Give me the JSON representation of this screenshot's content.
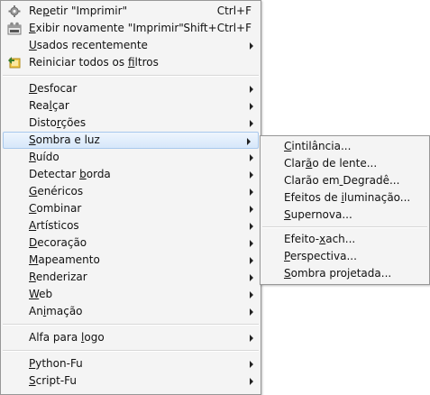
{
  "main_menu": {
    "items": [
      {
        "label": "Repetir \"Imprimir\"",
        "underline_index": 2,
        "shortcut": "Ctrl+F",
        "icon": "repeat-gear-icon"
      },
      {
        "label": "Exibir novamente \"Imprimir\"",
        "underline_index": 0,
        "shortcut": "Shift+Ctrl+F",
        "icon": "reshow-dialog-icon"
      },
      {
        "label": "Usados recentemente",
        "underline_index": 0,
        "submenu": true
      },
      {
        "label": "Reiniciar todos os filtros",
        "underline_index": 19,
        "icon": "reset-filters-icon"
      },
      {
        "label": "Desfocar",
        "underline_index": 0,
        "submenu": true
      },
      {
        "label": "Realçar",
        "underline_index": 3,
        "submenu": true
      },
      {
        "label": "Distorções",
        "underline_index": 5,
        "submenu": true
      },
      {
        "label": "Sombra e luz",
        "underline_index": 0,
        "submenu": true,
        "highlighted": true
      },
      {
        "label": "Ruído",
        "underline_index": 0,
        "submenu": true
      },
      {
        "label": "Detectar borda",
        "underline_index": 9,
        "submenu": true
      },
      {
        "label": "Genéricos",
        "underline_index": 0,
        "submenu": true
      },
      {
        "label": "Combinar",
        "underline_index": 0,
        "submenu": true
      },
      {
        "label": "Artísticos",
        "underline_index": 0,
        "submenu": true
      },
      {
        "label": "Decoração",
        "underline_index": 0,
        "submenu": true
      },
      {
        "label": "Mapeamento",
        "underline_index": 0,
        "submenu": true
      },
      {
        "label": "Renderizar",
        "underline_index": 0,
        "submenu": true
      },
      {
        "label": "Web",
        "underline_index": 0,
        "submenu": true
      },
      {
        "label": "Animação",
        "underline_index": 2,
        "submenu": true
      },
      {
        "label": "Alfa para logo",
        "underline_index": 10,
        "submenu": true
      },
      {
        "label": "Python-Fu",
        "underline_index": 0,
        "submenu": true
      },
      {
        "label": "Script-Fu",
        "underline_index": 0,
        "submenu": true
      }
    ]
  },
  "submenu": {
    "items": [
      {
        "label": "Cintilância...",
        "underline_index": 0
      },
      {
        "label": "Clarão de lente...",
        "underline_index": 4
      },
      {
        "label": "Clarão em Degradê...",
        "underline_index": 9
      },
      {
        "label": "Efeitos de iluminação...",
        "underline_index": 11
      },
      {
        "label": "Supernova...",
        "underline_index": 0
      },
      {
        "label": "Efeito-xach...",
        "underline_index": 7
      },
      {
        "label": "Perspectiva...",
        "underline_index": 0
      },
      {
        "label": "Sombra projetada...",
        "underline_index": 0
      }
    ]
  },
  "colors": {
    "menu_background": "#f4f4f4",
    "highlight_border": "#a8c8ec",
    "highlight_fill": "#d6e7fa",
    "separator": "#d7d7d7"
  }
}
